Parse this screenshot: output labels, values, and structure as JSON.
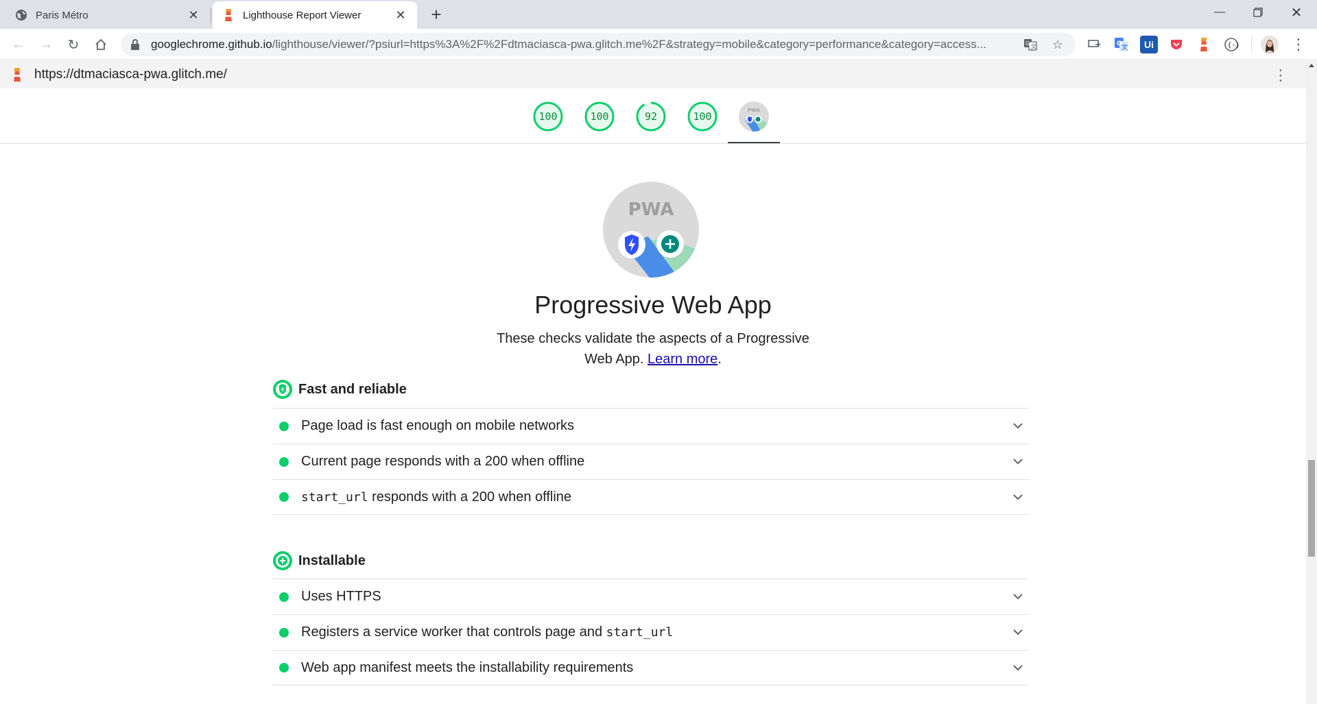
{
  "tabs": [
    {
      "title": "Paris Métro",
      "active": false,
      "icon": "globe-icon"
    },
    {
      "title": "Lighthouse Report Viewer",
      "active": true,
      "icon": "lighthouse-icon"
    }
  ],
  "toolbar": {
    "url_host": "googlechrome.github.io",
    "url_path": "/lighthouse/viewer/?psiurl=https%3A%2F%2Fdtmaciasca-pwa.glitch.me%2F&strategy=mobile&category=performance&category=access..."
  },
  "extensions": {
    "ui_label": "Ui"
  },
  "report": {
    "url": "https://dtmaciasca-pwa.glitch.me/"
  },
  "gauges": [
    {
      "score": "100"
    },
    {
      "score": "100"
    },
    {
      "score": "92"
    },
    {
      "score": "100"
    }
  ],
  "pwa_badge": {
    "label": "PWA"
  },
  "category": {
    "title": "Progressive Web App",
    "description": "These checks validate the aspects of a Progressive Web App.",
    "learn_more": "Learn more",
    "period": "."
  },
  "groups": [
    {
      "title": "Fast and reliable",
      "audits": [
        {
          "text": "Page load is fast enough on mobile networks"
        },
        {
          "text": "Current page responds with a 200 when offline"
        },
        {
          "code": "start_url",
          "text": " responds with a 200 when offline"
        }
      ]
    },
    {
      "title": "Installable",
      "audits": [
        {
          "text": "Uses HTTPS"
        },
        {
          "text": "Registers a service worker that controls page and ",
          "code": "start_url"
        },
        {
          "text": "Web app manifest meets the installability requirements"
        }
      ]
    }
  ],
  "colors": {
    "pass": "#0cce6b",
    "gauge_text": "#0a8a3a",
    "link": "#1a0dab"
  }
}
